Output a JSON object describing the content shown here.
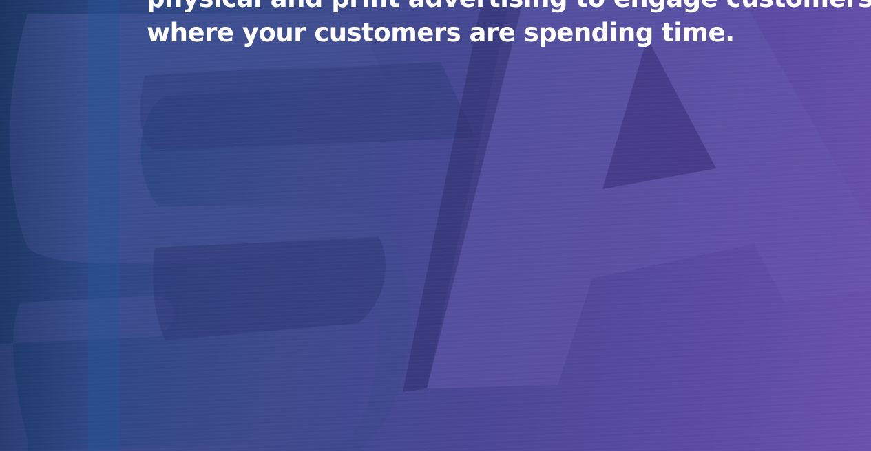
{
  "hero": {
    "background_image": "brushed-metal-sa-letters",
    "headline_line_1": "physical and print advertising to engage customers in the places where they",
    "headline_line_2": "where your customers are spending time.",
    "gradient_start": "#213f73",
    "gradient_end": "#6a52ac",
    "text_color": "#ffffff"
  }
}
